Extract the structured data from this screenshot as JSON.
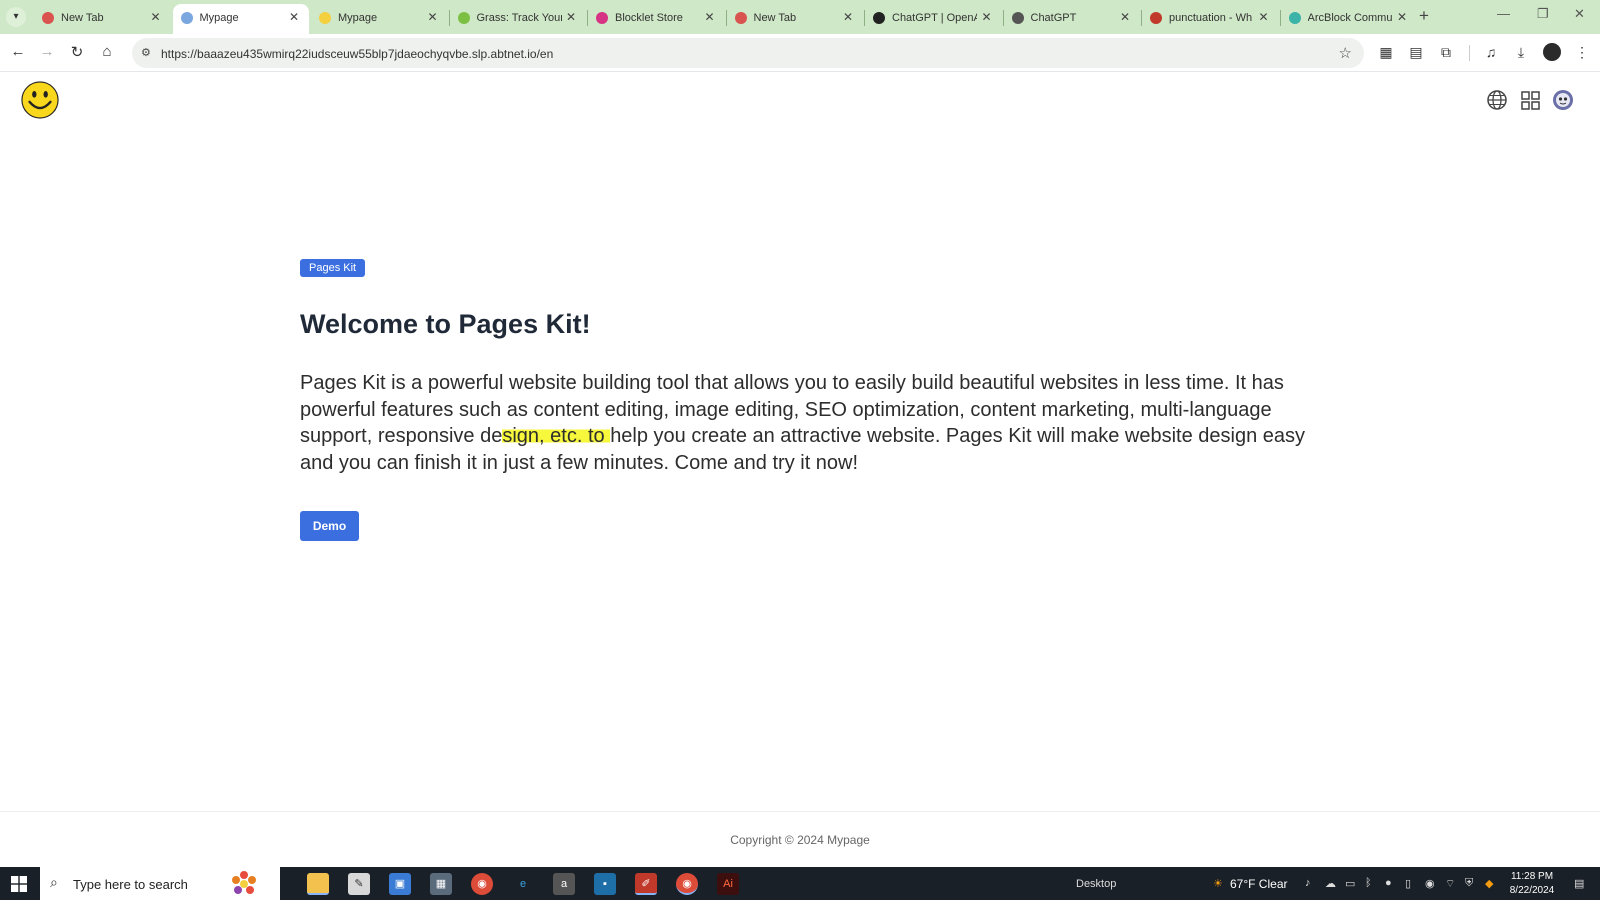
{
  "browser": {
    "tabs": [
      {
        "label": "New Tab",
        "icon": "opera-icon",
        "color": "#d9534f"
      },
      {
        "label": "Mypage",
        "icon": "page-icon",
        "color": "#7aa7e0",
        "active": true
      },
      {
        "label": "Mypage",
        "icon": "smiley-icon",
        "color": "#f4d03f"
      },
      {
        "label": "Grass: Track Your",
        "icon": "grass-icon",
        "color": "#7bc043"
      },
      {
        "label": "Blocklet Store",
        "icon": "blocklet-icon",
        "color": "#d63384"
      },
      {
        "label": "New Tab",
        "icon": "opera-icon",
        "color": "#d9534f"
      },
      {
        "label": "ChatGPT | OpenAI",
        "icon": "openai-icon",
        "color": "#222222"
      },
      {
        "label": "ChatGPT",
        "icon": "openai-icon",
        "color": "#555555"
      },
      {
        "label": "punctuation - Wh",
        "icon": "site-icon",
        "color": "#c0392b"
      },
      {
        "label": "ArcBlock Commu",
        "icon": "arcblock-icon",
        "color": "#3bb3a9"
      }
    ],
    "new_tab_symbol": "+",
    "url": "https://baaazeu435wmirq22iudsceuw55blp7jdaeochyqvbe.slp.abtnet.io/en"
  },
  "page": {
    "logo": "smiley-logo",
    "badge": "Pages Kit",
    "title": "Welcome to Pages Kit!",
    "desc_before": "Pages Kit is a powerful website building tool that allows you to easily build beautiful websites in less time. It has powerful features such as content editing, image editing, SEO optimization, content marketing, multi-language support, responsive de",
    "desc_highlight": "sign, etc. to ",
    "desc_after": "help you create an attractive website. Pages Kit will make website design easy and you can finish it in just a few minutes. Come and try it now!",
    "demo_label": "Demo",
    "copyright": "Copyright © 2024 Mypage",
    "colors": {
      "accent": "#3b6fe0",
      "highlight": "#f7f73b",
      "tab_strip": "#cfe8c7"
    }
  },
  "taskbar": {
    "search_placeholder": "Type here to search",
    "desktop_label": "Desktop",
    "weather": "67°F  Clear",
    "time": "11:28 PM",
    "date": "8/22/2024"
  }
}
